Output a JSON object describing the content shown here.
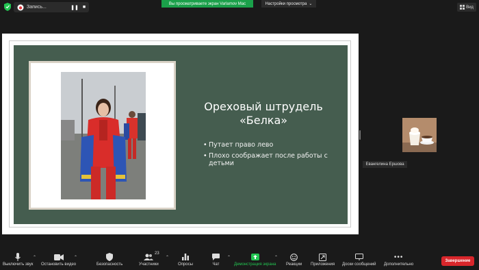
{
  "topbar": {
    "recording_label": "Запись...",
    "share_banner": "Вы просматриваете экран Varlamov Mac",
    "view_options_label": "Настройки просмотра",
    "view_button_label": "Вид"
  },
  "slide": {
    "title": "Ореховый штрудель «Белка»",
    "bullets": [
      "Путает право лево",
      "Плохо соображает после работы с детьми"
    ],
    "bg_color": "#455d4f"
  },
  "participant": {
    "name": "Евангелина Ершова"
  },
  "toolbar": {
    "mute": "Выключить звук",
    "video": "Остановить видео",
    "security": "Безопасность",
    "participants": "Участники",
    "participants_count": "23",
    "polls": "Опросы",
    "chat": "Чат",
    "share": "Демонстрация экрана",
    "reactions": "Реакции",
    "apps": "Приложения",
    "whiteboards": "Доски сообщений",
    "more": "Дополнительно",
    "end": "Завершение"
  },
  "colors": {
    "share_green": "#1aa04a",
    "end_red": "#d9262b",
    "share_icon_green": "#23c552"
  }
}
